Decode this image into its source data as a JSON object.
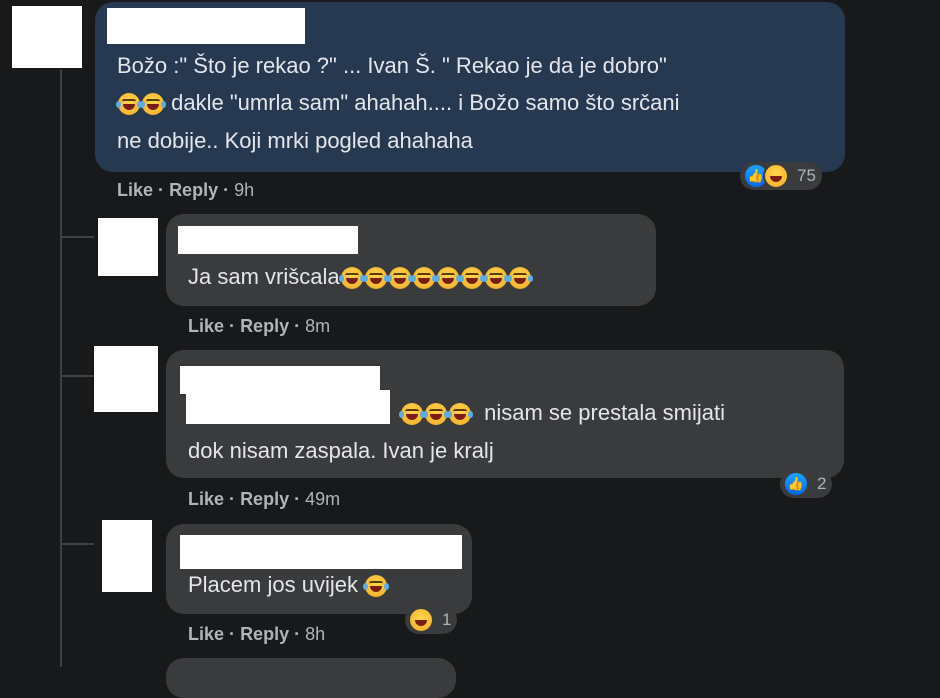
{
  "comments": [
    {
      "text_lines": [
        "Božo :\" Što je rekao ?\" ... Ivan Š. \" Rekao je da je dobro\"",
        "dakle \"umrla sam\" ahahah.... i Božo samo što srčani",
        "ne dobije.. Koji mrki pogled ahahaha"
      ],
      "like_label": "Like",
      "reply_label": "Reply",
      "time": "9h",
      "reaction_count": "75"
    },
    {
      "text": "Ja sam vrišcala",
      "like_label": "Like",
      "reply_label": "Reply",
      "time": "8m"
    },
    {
      "text_lines": [
        "nisam se prestala smijati",
        "dok nisam zaspala. Ivan je kralj"
      ],
      "like_label": "Like",
      "reply_label": "Reply",
      "time": "49m",
      "reaction_count": "2"
    },
    {
      "text": "Placem jos uvijek",
      "like_label": "Like",
      "reply_label": "Reply",
      "time": "8h",
      "reaction_count": "1"
    }
  ],
  "separator": "·",
  "icons": {
    "laugh": "laughing-tears-emoji-icon",
    "like": "like-reaction-icon",
    "haha": "haha-reaction-icon"
  },
  "colors": {
    "background": "#18191a",
    "bubble": "#3a3b3c",
    "highlight_bubble": "#263951",
    "like_blue": "#0866ff"
  }
}
